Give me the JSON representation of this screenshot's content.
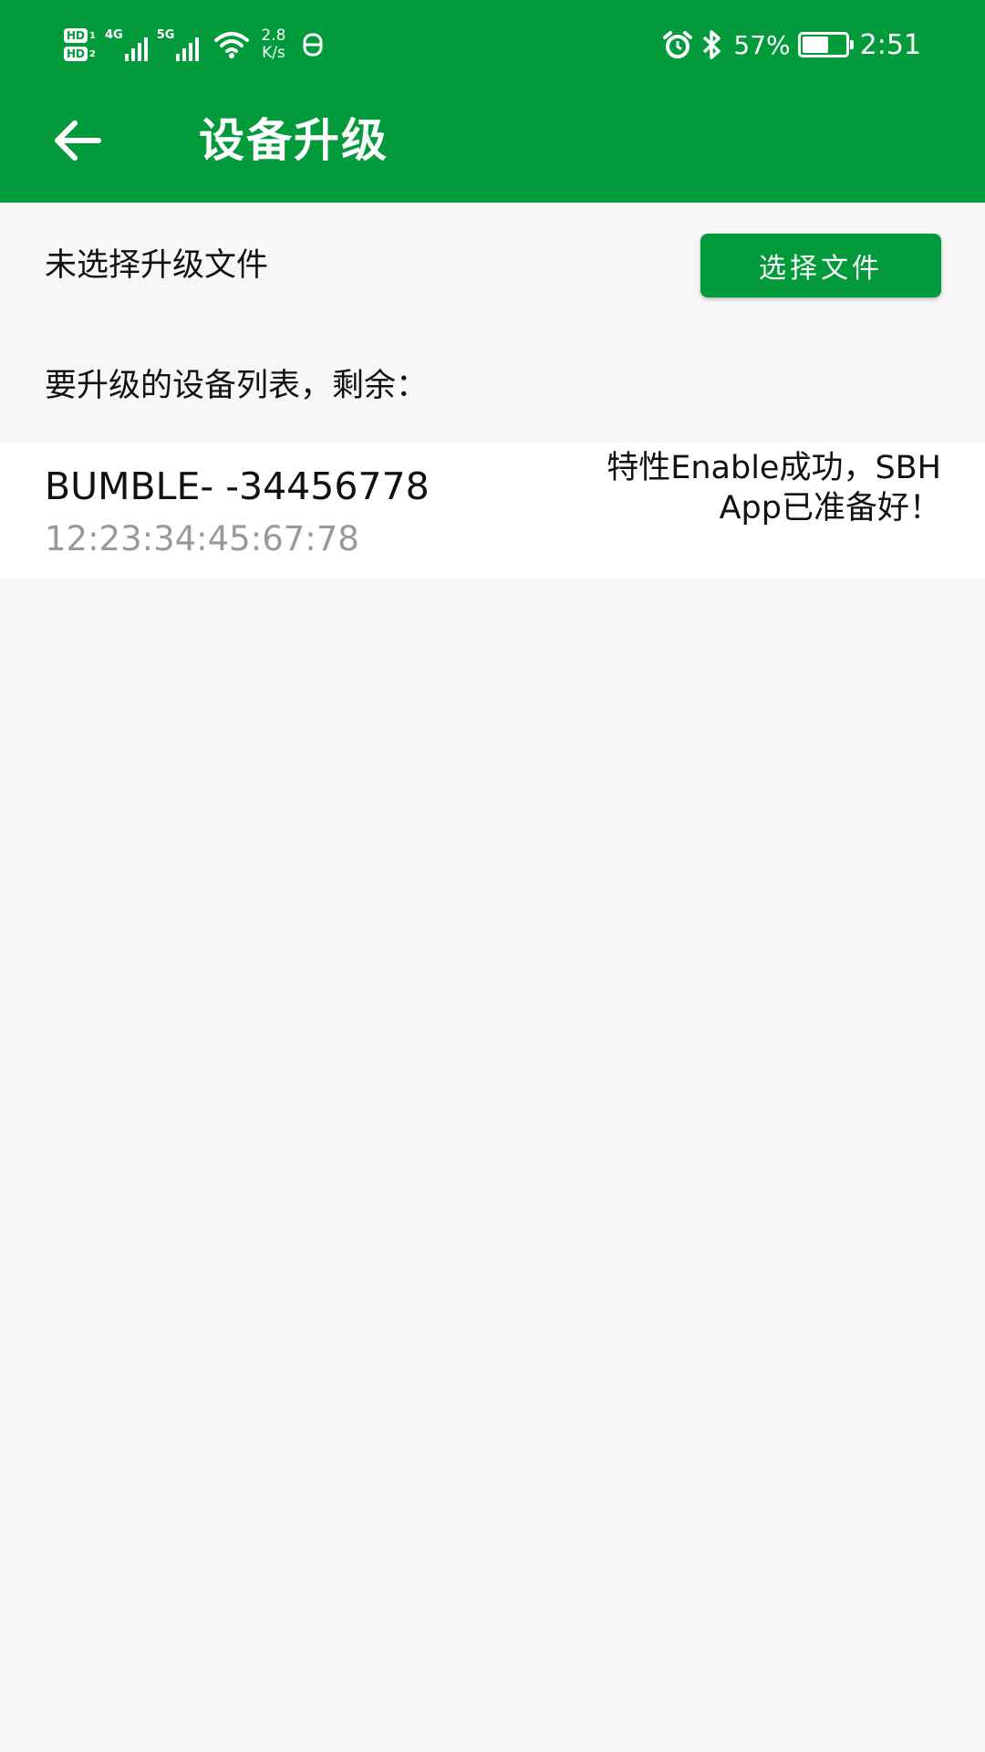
{
  "status_bar": {
    "sim1_label": "HD",
    "sim1_index": "1",
    "sim2_label": "HD",
    "sim2_index": "2",
    "signal1_type": "4G",
    "signal2_type": "5G",
    "net_speed_value": "2.8",
    "net_speed_unit": "K/s",
    "icons": [
      "hd-icon",
      "signal-icon",
      "wifi-icon",
      "notification-icon",
      "alarm-icon",
      "bluetooth-icon",
      "battery-icon"
    ],
    "battery_percent": "57%",
    "battery_level": 0.57,
    "time": "2:51"
  },
  "toolbar": {
    "title": "设备升级",
    "background_color": "#029a3a"
  },
  "file_section": {
    "status_text": "未选择升级文件",
    "button_label": "选择文件"
  },
  "device_list": {
    "label": "要升级的设备列表，剩余：",
    "items": [
      {
        "name": "BUMBLE- -34456778",
        "mac": "12:23:34:45:67:78",
        "status": "特性Enable成功，SBH App已准备好！"
      }
    ]
  },
  "colors": {
    "accent": "#029a3a",
    "background": "#f7f7f7",
    "secondary_text": "#999999"
  }
}
